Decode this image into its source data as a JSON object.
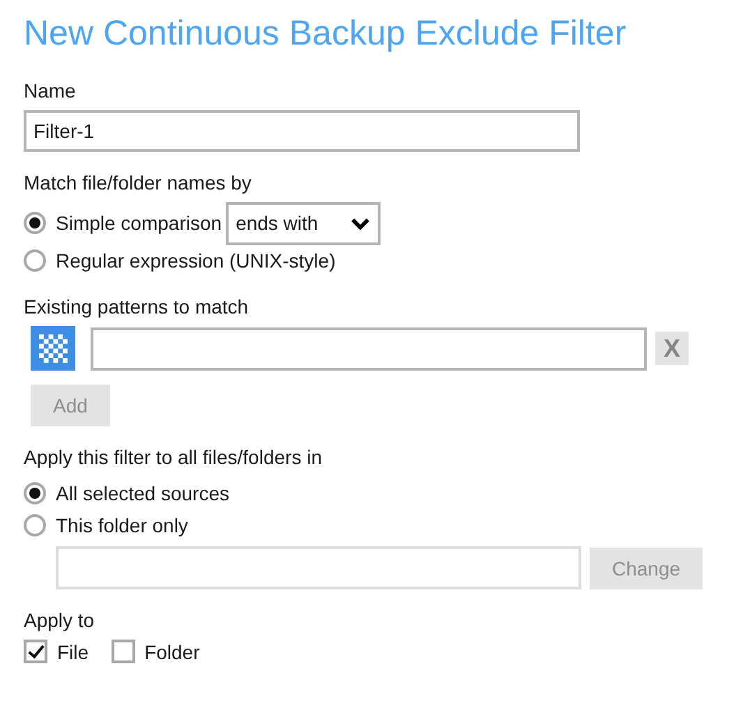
{
  "title": "New Continuous Backup Exclude Filter",
  "name_field": {
    "label": "Name",
    "value": "Filter-1"
  },
  "match": {
    "label": "Match file/folder names by",
    "options": [
      {
        "label": "Simple comparison",
        "selected": true,
        "kind": "dropdown",
        "dropdown_value": "ends with"
      },
      {
        "label": "Regular expression (UNIX-style)",
        "selected": false,
        "kind": "plain"
      }
    ]
  },
  "patterns": {
    "label": "Existing patterns to match",
    "rows": [
      {
        "delete_button": {
          "label": "X",
          "disabled": true
        }
      }
    ],
    "add_button": {
      "label": "Add",
      "disabled": true
    }
  },
  "scope": {
    "label": "Apply this filter to all files/folders in",
    "options": [
      {
        "label": "All selected sources",
        "selected": true
      },
      {
        "label": "This folder only",
        "selected": false
      }
    ],
    "change_button": {
      "label": "Change",
      "disabled": true
    }
  },
  "apply_to": {
    "label": "Apply to",
    "options": [
      {
        "label": "File",
        "checked": true
      },
      {
        "label": "Folder",
        "checked": false
      }
    ]
  }
}
